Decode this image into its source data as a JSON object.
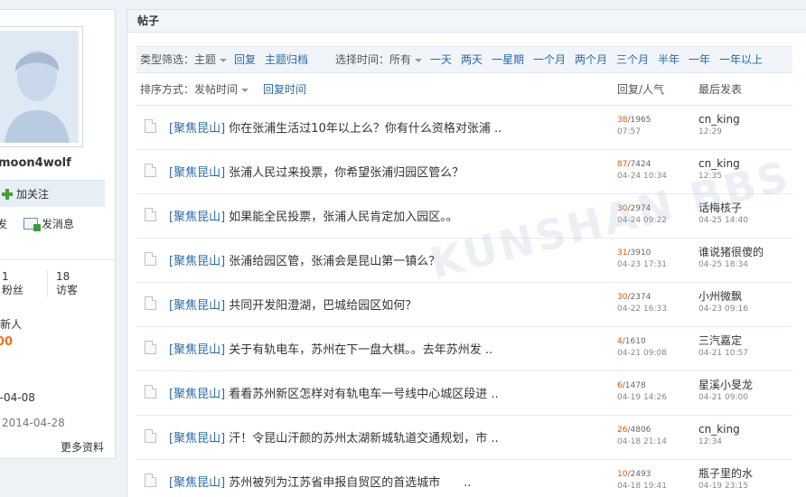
{
  "profile": {
    "username": "moon4wolf",
    "follow_label": "加关注",
    "action_left": "发",
    "message_label": "发消息",
    "stats": [
      {
        "value": "1",
        "label": "粉丝"
      },
      {
        "value": "18",
        "label": "访客"
      }
    ],
    "group": "新人",
    "points": "00",
    "date1": "4-04-08",
    "date2": "2014-04-28",
    "more_label": "更多资料"
  },
  "posts": {
    "header": "帖子",
    "filter": {
      "type_label": "类型筛选：",
      "type_value": "主题",
      "reply": "回复",
      "archive": "主题归档",
      "time_label": "选择时间：",
      "time_value": "所有",
      "ranges": [
        "一天",
        "两天",
        "一星期",
        "一个月",
        "两个月",
        "三个月",
        "半年",
        "一年",
        "一年以上"
      ]
    },
    "sort": {
      "label": "排序方式：",
      "value": "发帖时间",
      "reply_time": "回复时间",
      "col_counts": "回复/人气",
      "col_last": "最后发表"
    },
    "watermark": "KUNSHAN BBS",
    "rows": [
      {
        "tag": "[聚焦昆山]",
        "title": "你在张浦生活过10年以上么？你有什么资格对张浦 ..",
        "replies": "38",
        "views": "/1965",
        "time": "07:57",
        "last_user": "cn_king",
        "last_time": "12:29"
      },
      {
        "tag": "[聚焦昆山]",
        "title": "张浦人民过来投票，你希望张浦归园区管么？",
        "replies": "87",
        "views": "/7424",
        "time": "04-24 10:34",
        "last_user": "cn_king",
        "last_time": "12:35"
      },
      {
        "tag": "[聚焦昆山]",
        "title": "如果能全民投票，张浦人民肯定加入园区。。",
        "replies": "30",
        "views": "/2974",
        "time": "04-24 09:22",
        "last_user": "话梅核子",
        "last_time": "04-25 14:40"
      },
      {
        "tag": "[聚焦昆山]",
        "title": "张浦给园区管，张浦会是昆山第一镇么？",
        "replies": "31",
        "views": "/3910",
        "time": "04-23 17:31",
        "last_user": "谁说猪很傻的",
        "last_time": "04-25 18:34"
      },
      {
        "tag": "[聚焦昆山]",
        "title": "共同开发阳澄湖，巴城给园区如何？",
        "replies": "30",
        "views": "/2374",
        "time": "04-22 16:33",
        "last_user": "小州微飘",
        "last_time": "04-23 09:16"
      },
      {
        "tag": "[聚焦昆山]",
        "title": "关于有轨电车，苏州在下一盘大棋。。去年苏州发 ..",
        "replies": "4",
        "views": "/1610",
        "time": "04-21 09:08",
        "last_user": "三汽嘉定",
        "last_time": "04-21 10:57"
      },
      {
        "tag": "[聚焦昆山]",
        "title": "看看苏州新区怎样对有轨电车一号线中心城区段进 ..",
        "replies": "6",
        "views": "/1478",
        "time": "04-19 14:26",
        "last_user": "星溪小旻龙",
        "last_time": "04-21 09:00"
      },
      {
        "tag": "[聚焦昆山]",
        "title": "汗！令昆山汗颜的苏州太湖新城轨道交通规划，市 ..",
        "replies": "26",
        "views": "/4806",
        "time": "04-18 21:14",
        "last_user": "cn_king",
        "last_time": "12:34"
      },
      {
        "tag": "[聚焦昆山]",
        "title": "苏州被列为江苏省申报自贸区的首选城市　　..",
        "replies": "10",
        "views": "/2493",
        "time": "04-18 19:41",
        "last_user": "瓶子里的水",
        "last_time": "04-19 23:15"
      }
    ]
  }
}
